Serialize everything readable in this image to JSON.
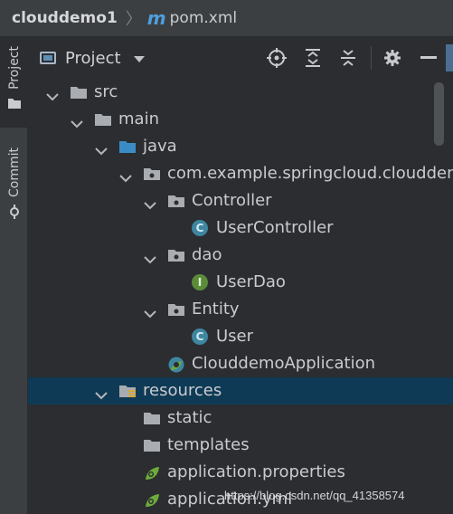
{
  "breadcrumb": {
    "root": "clouddemo1",
    "separator": "〉",
    "file_icon": "m",
    "file": "pom.xml"
  },
  "sidebar": {
    "tabs": [
      {
        "label": "Project",
        "icon": "folder-icon",
        "active": true
      },
      {
        "label": "Commit",
        "icon": "commit-icon",
        "active": false
      }
    ]
  },
  "project_panel": {
    "title": "Project",
    "toolbar": [
      "locate-icon",
      "expand-all-icon",
      "collapse-all-icon",
      "gear-icon",
      "minimize-icon"
    ]
  },
  "tree": [
    {
      "label": "src",
      "icon": "folder-icon",
      "expanded": true,
      "depth": 0
    },
    {
      "label": "main",
      "icon": "folder-icon",
      "expanded": true,
      "depth": 1
    },
    {
      "label": "java",
      "icon": "source-folder-icon",
      "expanded": true,
      "depth": 2
    },
    {
      "label": "com.example.springcloud.cloudden",
      "icon": "package-icon",
      "expanded": true,
      "depth": 3
    },
    {
      "label": "Controller",
      "icon": "package-icon",
      "expanded": true,
      "depth": 4
    },
    {
      "label": "UserController",
      "icon": "class-icon",
      "glyph": "C",
      "depth": 5
    },
    {
      "label": "dao",
      "icon": "package-icon",
      "expanded": true,
      "depth": 4
    },
    {
      "label": "UserDao",
      "icon": "interface-icon",
      "glyph": "I",
      "depth": 5
    },
    {
      "label": "Entity",
      "icon": "package-icon",
      "expanded": true,
      "depth": 4
    },
    {
      "label": "User",
      "icon": "class-icon",
      "glyph": "C",
      "depth": 5
    },
    {
      "label": "ClouddemoApplication",
      "icon": "spring-boot-class-icon",
      "depth": 4
    },
    {
      "label": "resources",
      "icon": "resources-folder-icon",
      "expanded": true,
      "depth": 2,
      "selected": true
    },
    {
      "label": "static",
      "icon": "folder-icon",
      "depth": 3
    },
    {
      "label": "templates",
      "icon": "folder-icon",
      "depth": 3
    },
    {
      "label": "application.properties",
      "icon": "spring-properties-icon",
      "depth": 3
    },
    {
      "label": "application.yml",
      "icon": "spring-yml-icon",
      "depth": 3
    }
  ],
  "watermark": "https://blog.csdn.net/qq_41358574",
  "colors": {
    "background": "#2b2d30",
    "selection": "#0f3a55",
    "class_icon": "#3e86a0",
    "interface_icon": "#5b8c3a",
    "source_folder": "#3b8cc6",
    "maven_icon": "#4f9ede"
  }
}
